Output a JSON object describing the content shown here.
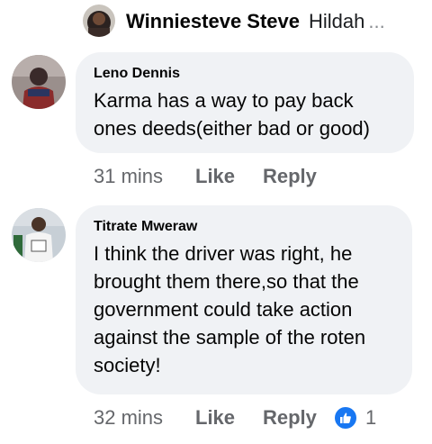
{
  "top_reply": {
    "author": "Winniesteve Steve",
    "preview": "Hildah",
    "ellipsis": "..."
  },
  "comments": [
    {
      "author": "Leno Dennis",
      "text": "Karma has a way to pay back ones deeds(either bad or good)",
      "time": "31 mins",
      "like_label": "Like",
      "reply_label": "Reply"
    },
    {
      "author": "Titrate Mweraw",
      "text": "I think the driver was right, he brought them there,so that the government could take action against the sample of the roten society!",
      "time": "32 mins",
      "like_label": "Like",
      "reply_label": "Reply",
      "reaction_count": "1"
    }
  ],
  "colors": {
    "bubble": "#f0f2f5",
    "meta_text": "#65676b",
    "like_blue": "#1877f2"
  }
}
